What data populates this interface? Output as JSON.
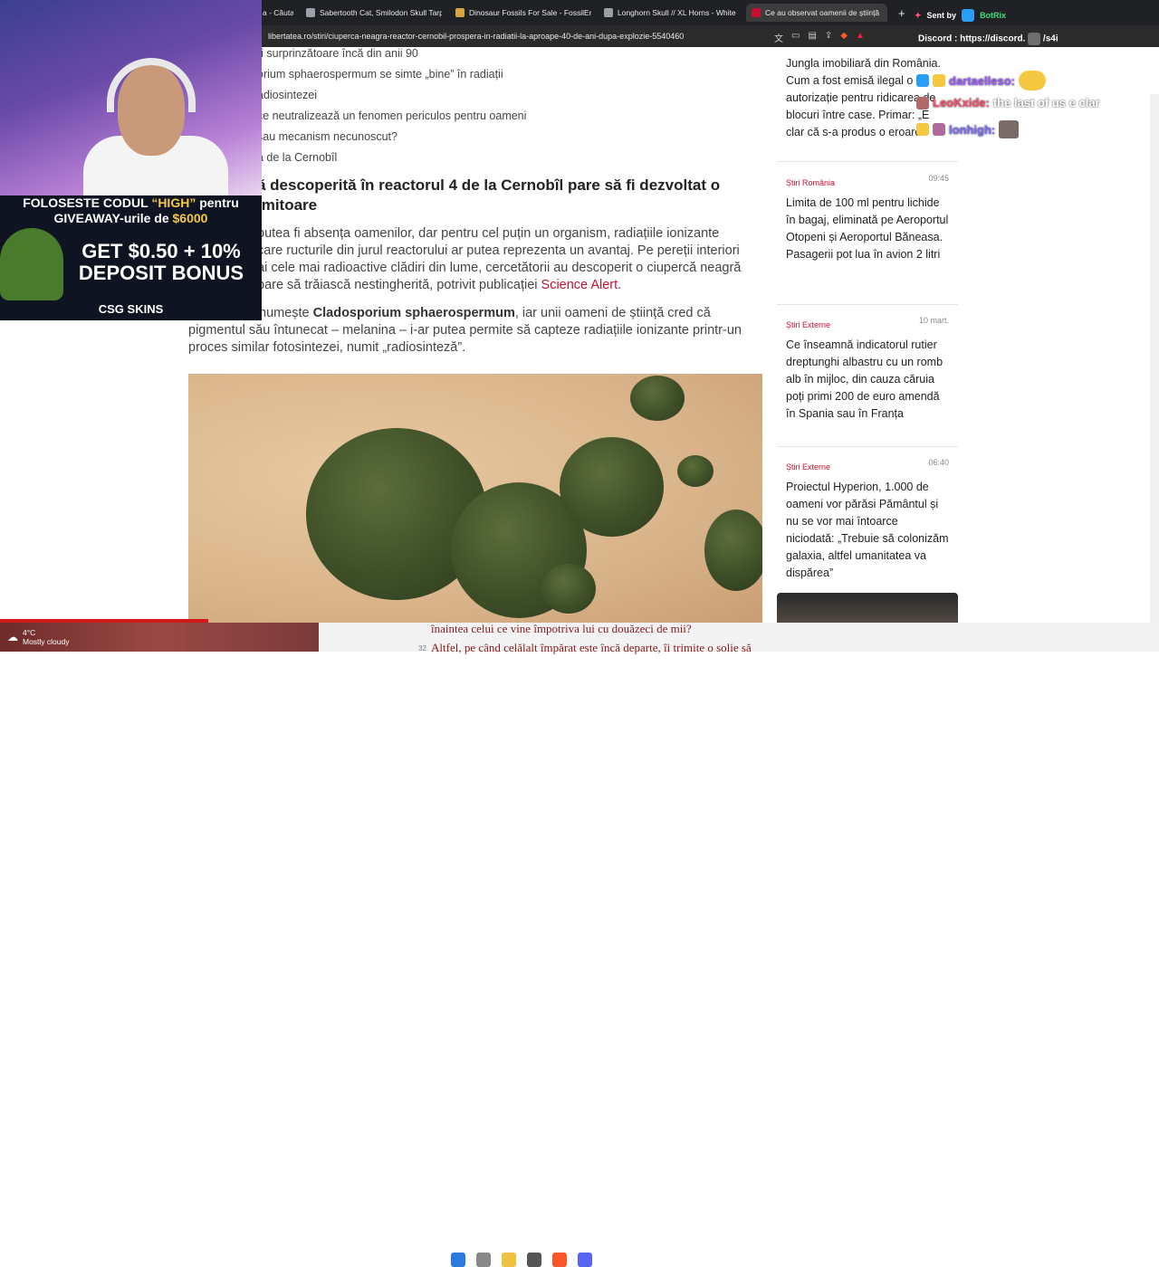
{
  "tabs": [
    {
      "label": "a - Căuta"
    },
    {
      "label": "Sabertooth Cat, Smilodon Skull Tarpi"
    },
    {
      "label": "Dinosaur Fossils For Sale - FossilEra.c"
    },
    {
      "label": "Longhorn Skull // XL Horns - White S"
    },
    {
      "label": "Ce au observat oamenii de știință"
    }
  ],
  "new_tab": "+",
  "url": "libertatea.ro/stiri/ciuperca-neagra-reactor-cernobil-prospera-in-radiatii-la-aproape-40-de-ani-dupa-explozie-5540460",
  "toc": [
    "ri surprinzătoare încă din anii 90",
    "orium sphaerospermum se simte „bine” în radiații",
    "adiosintezei",
    "ce neutralizează un fenomen periculos pentru oameni",
    "sau mecanism necunoscut?",
    "ă de la Cernobîl"
  ],
  "heading": "ă descoperită în reactorul 4 de la Cernobîl pare să fi dezvoltat o imitoare",
  "paragraph1": "putea fi absența oamenilor, dar pentru cel puțin un organism, radiațiile ionizante care ructurile din jurul reactorului ar putea reprezenta un avantaj. Pe pereții interiori ai cele mai radioactive clădiri din lume, cercetătorii au descoperit o ciupercă neagră pare să trăiască nestingherită, potrivit publicației",
  "paragraph1_link": "Science Alert",
  "paragraph1_end": ".",
  "paragraph2_start": "numește",
  "paragraph2_bold": "Cladosporium sphaerospermum",
  "paragraph2_rest": ", iar unii oameni de știință cred că pigmentul său întunecat – melanina – i-ar putea permite să capteze radiațiile ionizante printr-un proces similar fotosintezei, numit „radiosinteză”.",
  "sidebar": {
    "top_title": "Jungla imobiliară din România. Cum a fost emisă ilegal o autorizație pentru ridicarea de blocuri între case. Primar: „E clar că s-a produs o eroare”",
    "cards": [
      {
        "category": "Știri România",
        "time": "09:45",
        "title": "Limita de 100 ml pentru lichide în bagaj, eliminată pe Aeroportul Otopeni și Aeroportul Băneasa. Pasagerii pot lua în avion 2 litri"
      },
      {
        "category": "Știri Externe",
        "time": "10 mart.",
        "title": "Ce înseamnă indicatorul rutier dreptunghi albastru cu un romb alb în mijloc, din cauza căruia poți primi 200 de euro amendă în Spania sau în Franța"
      },
      {
        "category": "Știri Externe",
        "time": "06:40",
        "title": "Proiectul Hyperion, 1.000 de oameni vor părăsi Pământul și nu se vor mai întoarce niciodată: „Trebuie să colonizăm galaxia, altfel umanitatea va dispărea”"
      }
    ]
  },
  "promo": {
    "line1_a": "FOLOSESTE CODUL ",
    "line1_code": "“HIGH”",
    "line1_b": " pentru",
    "line2_a": "GIVEAWAY-urile de ",
    "line2_amount": "$6000",
    "big1": "GET $0.50 + 10%",
    "big2": "DEPOSIT BONUS",
    "brand": "CSG SKINS"
  },
  "chat": {
    "sent_by": "Sent by",
    "bot": "BotRix",
    "discord_label": "Discord",
    "discord_link": ": https://discord.",
    "discord_link_end": "/s4i",
    "lines": [
      {
        "user": "dartaelleso:",
        "msg": "",
        "color": "#9b59ff"
      },
      {
        "user": "LeoKxide:",
        "msg": "the last of us e clar",
        "color": "#ff4d6d"
      },
      {
        "user": "lonhigh:",
        "msg": "",
        "color": "#7b6bff"
      }
    ]
  },
  "weather": {
    "temp": "4°C",
    "desc": "Mostly cloudy"
  },
  "bible_line1": "înaintea celui ce vine împotriva lui cu douăzeci de mii?",
  "bible_line2": "Altfel, pe când celălalt împărat este încă departe, îi trimite o solie să",
  "verse_num": "32",
  "colors": {
    "accent_red": "#c8102e",
    "chrome_dark": "#202124"
  }
}
